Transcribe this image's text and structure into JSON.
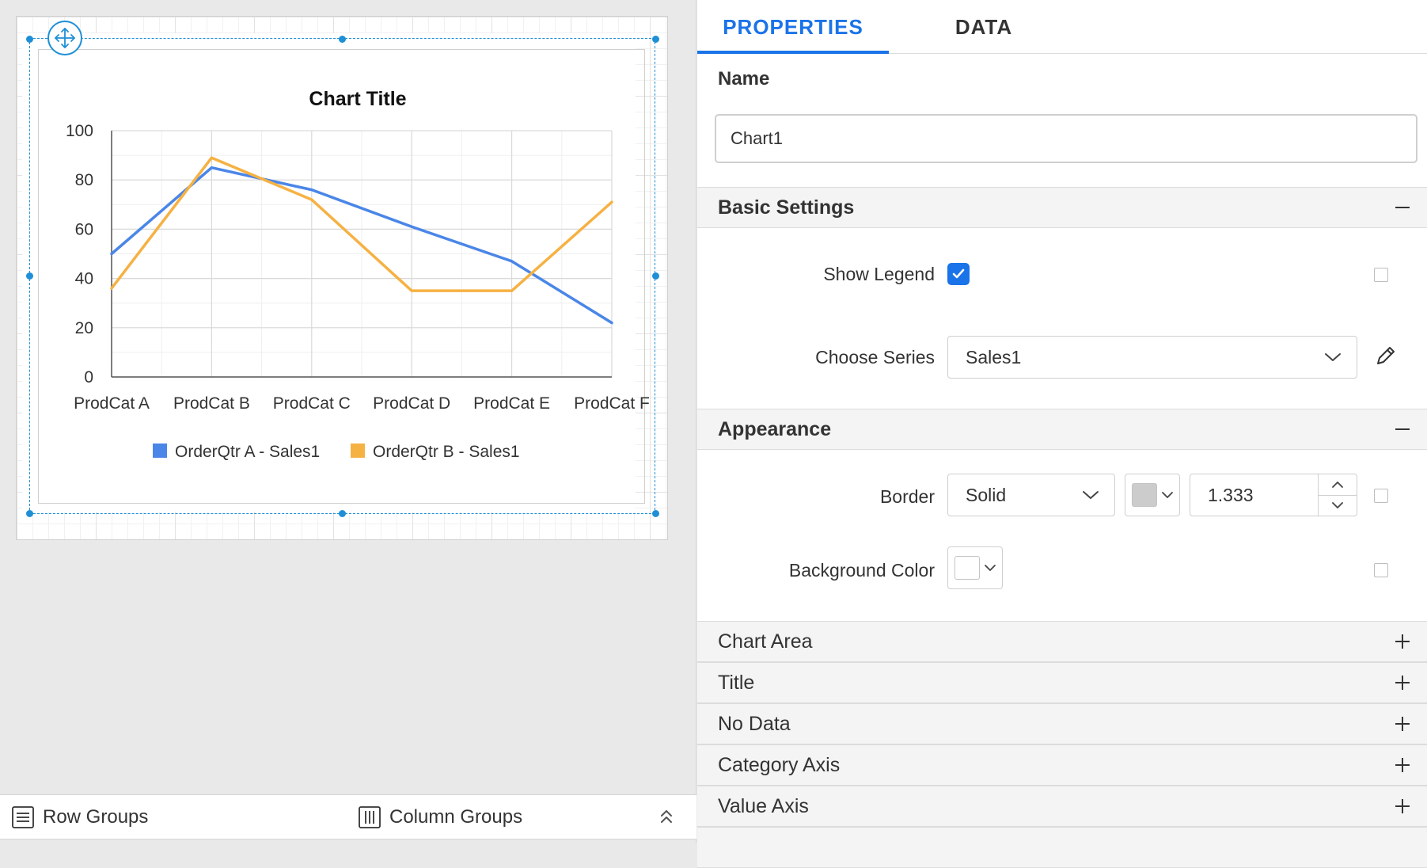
{
  "bottom_bar": {
    "row_groups_label": "Row Groups",
    "column_groups_label": "Column Groups"
  },
  "panel": {
    "tabs": [
      {
        "label": "PROPERTIES",
        "active": true
      },
      {
        "label": "DATA",
        "active": false
      }
    ],
    "name": {
      "label": "Name",
      "value": "Chart1"
    },
    "basic_settings": {
      "title": "Basic Settings",
      "expanded": true,
      "show_legend_label": "Show Legend",
      "show_legend_checked": true,
      "choose_series_label": "Choose Series",
      "choose_series_value": "Sales1"
    },
    "appearance": {
      "title": "Appearance",
      "expanded": true,
      "border_label": "Border",
      "border_style": "Solid",
      "border_color": "#cccccc",
      "border_width": "1.333",
      "background_color_label": "Background Color",
      "background_color": "#ffffff"
    },
    "collapsed_sections": [
      "Chart Area",
      "Title",
      "No Data",
      "Category Axis",
      "Value Axis"
    ],
    "accent_color": "#1a73e8"
  },
  "chart_data": {
    "type": "line",
    "title": "Chart Title",
    "categories": [
      "ProdCat A",
      "ProdCat B",
      "ProdCat C",
      "ProdCat D",
      "ProdCat E",
      "ProdCat F"
    ],
    "series": [
      {
        "name": "OrderQtr A - Sales1",
        "color": "#4a86e8",
        "values": [
          50,
          85,
          76,
          61,
          47,
          22
        ]
      },
      {
        "name": "OrderQtr B - Sales1",
        "color": "#f6b143",
        "values": [
          36,
          89,
          72,
          35,
          35,
          71
        ]
      }
    ],
    "ylim": [
      0,
      100
    ],
    "yticks": [
      0,
      20,
      40,
      60,
      80,
      100
    ],
    "grid": true,
    "legend_position": "bottom"
  }
}
